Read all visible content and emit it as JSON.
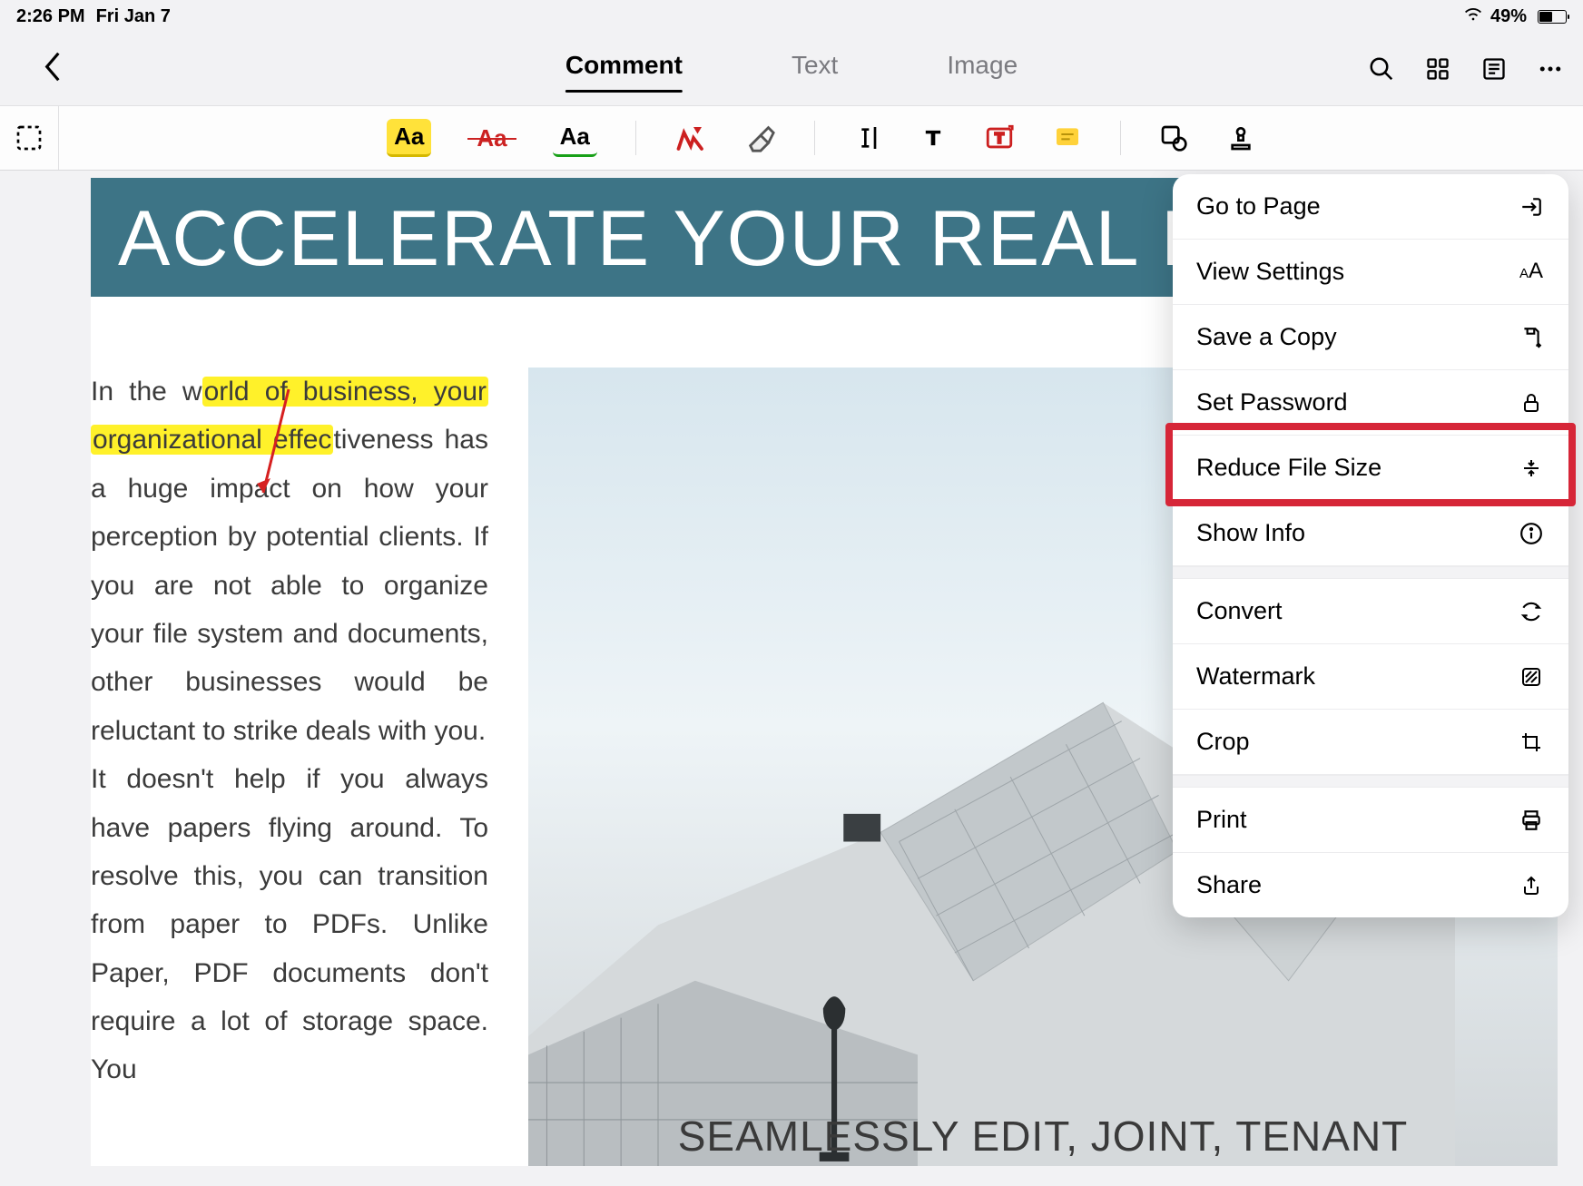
{
  "status": {
    "time": "2:26 PM",
    "date": "Fri Jan 7",
    "battery_pct": "49%"
  },
  "tabs": {
    "comment": "Comment",
    "text": "Text",
    "image": "Image"
  },
  "menu": {
    "go_to_page": "Go to Page",
    "view_settings": "View Settings",
    "save_copy": "Save a Copy",
    "set_password": "Set Password",
    "reduce": "Reduce File Size",
    "show_info": "Show Info",
    "convert": "Convert",
    "watermark": "Watermark",
    "crop": "Crop",
    "print": "Print",
    "share": "Share"
  },
  "doc": {
    "banner": "ACCELERATE YOUR REAL ESTATE",
    "p1_a": "In the w",
    "p1_hl1": "orld of business, your",
    "p1_hl2": "organizational effec",
    "p1_b": "tiveness has a huge impact on how your perception by potential clients. If you are not able to organize your file system and documents, other businesses would be reluctant to strike deals with you.",
    "p2": "It doesn't help if you always have papers flying around. To resolve this, you can transition from paper to PDFs. Unlike Paper, PDF documents don't require a lot of storage space. You",
    "subhead": "SEAMLESSLY EDIT, JOINT, TENANT"
  }
}
